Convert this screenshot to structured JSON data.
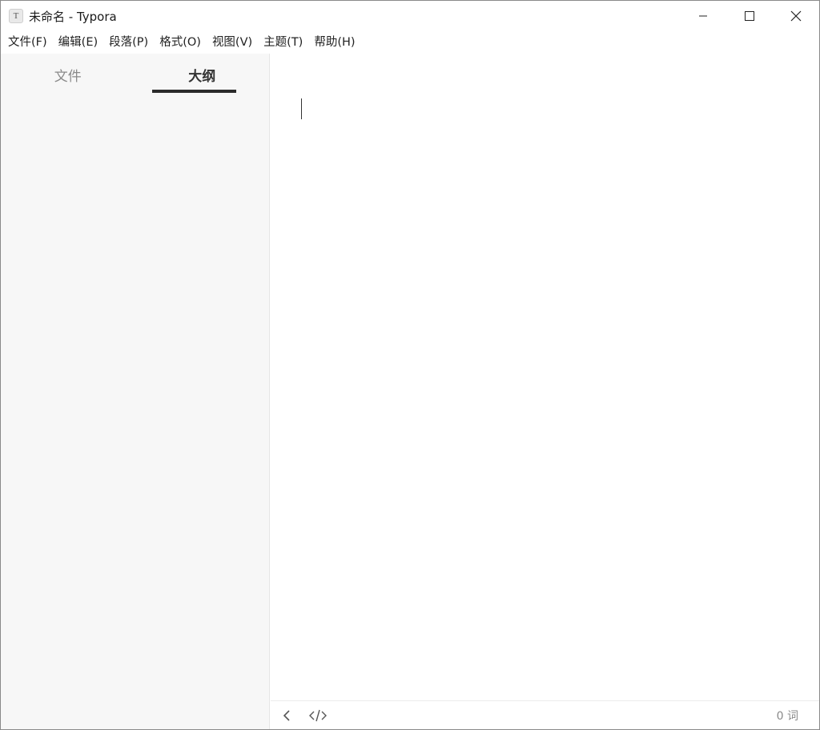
{
  "window": {
    "title": "未命名 - Typora",
    "icon_letter": "T",
    "controls": [
      "minimize-icon",
      "maximize-icon",
      "close-icon"
    ]
  },
  "menubar": {
    "items": [
      {
        "label": "文件(F)"
      },
      {
        "label": "编辑(E)"
      },
      {
        "label": "段落(P)"
      },
      {
        "label": "格式(O)"
      },
      {
        "label": "视图(V)"
      },
      {
        "label": "主题(T)"
      },
      {
        "label": "帮助(H)"
      }
    ]
  },
  "sidebar": {
    "tabs": [
      {
        "label": "文件",
        "active": false
      },
      {
        "label": "大纲",
        "active": true
      }
    ],
    "background": "#f7f7f7"
  },
  "editor": {
    "content": ""
  },
  "statusbar": {
    "back_icon": "chevron-left-icon",
    "source_icon": "code-icon",
    "word_count": "0 词"
  }
}
